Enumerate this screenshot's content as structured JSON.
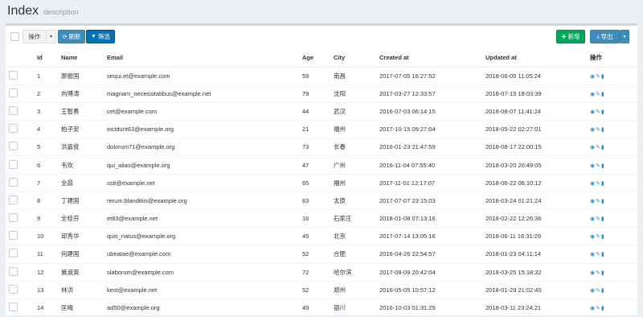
{
  "header": {
    "title": "Index",
    "description": "description"
  },
  "toolbar": {
    "actions_label": "操作",
    "refresh_label": "刷新",
    "filter_label": "筛选",
    "new_label": "新增",
    "export_label": "导出"
  },
  "table": {
    "columns": [
      "Id",
      "Name",
      "Email",
      "Age",
      "City",
      "Created at",
      "Updated at",
      "操作"
    ],
    "rows": [
      [
        "1",
        "廖振国",
        "sequi.et@example.com",
        "59",
        "南昌",
        "2017-07-05 16:27:52",
        "2018-06-05 11:05:24"
      ],
      [
        "2",
        "向博涛",
        "magnam_necessitatibus@example.net",
        "79",
        "沈阳",
        "2017-03-27 12:33:57",
        "2018-07-15 18:03:39"
      ],
      [
        "3",
        "王智勇",
        "cet@example.com",
        "44",
        "武汉",
        "2016-07-03 06:14:15",
        "2018-08-07 11:41:24"
      ],
      [
        "4",
        "柏子安",
        "incidunt63@example.org",
        "21",
        "福州",
        "2017-10-15 09:27:04",
        "2018-05-22 02:27:01"
      ],
      [
        "5",
        "洪嘉俊",
        "dolorum71@example.org",
        "73",
        "长春",
        "2016-01-23 21:47:59",
        "2018-08-17 22:00:15"
      ],
      [
        "6",
        "韦欢",
        "qui_alias@example.org",
        "47",
        "广州",
        "2016-11-04 07:55:40",
        "2018-03-20 20:49:05"
      ],
      [
        "7",
        "全晨",
        "ssit@example.net",
        "65",
        "福州",
        "2017-11-01 12:17:07",
        "2018-06-22 06:10:12"
      ],
      [
        "8",
        "丁建国",
        "rerum.blanditiis@example.org",
        "63",
        "太原",
        "2017-07-07 23:15:03",
        "2018-03-24 01:21:24"
      ],
      [
        "9",
        "全桂芬",
        "et83@example.net",
        "16",
        "石家庄",
        "2018-01-08 07:13:16",
        "2018-02-22 12:26:36"
      ],
      [
        "10",
        "邱秀华",
        "quis_natus@example.org",
        "45",
        "北京",
        "2017-07-14 13:05:16",
        "2018-06-11 16:31:29"
      ],
      [
        "11",
        "何建国",
        "ubeatae@example.com",
        "52",
        "合肥",
        "2016-04-26 22:54:57",
        "2018-01-23 04:11:14"
      ],
      [
        "12",
        "冀淑英",
        "slaborum@example.com",
        "72",
        "哈尔滨",
        "2017-08-09 20:42:04",
        "2018-03-25 15:18:32"
      ],
      [
        "13",
        "林洪",
        "kest@example.net",
        "52",
        "郑州",
        "2016-05-05 10:57:12",
        "2018-01-29 21:02:40"
      ],
      [
        "14",
        "匡梅",
        "ad50@example.org",
        "49",
        "银川",
        "2016-10-03 01:31:25",
        "2018-03-11 23:24:21"
      ]
    ]
  }
}
